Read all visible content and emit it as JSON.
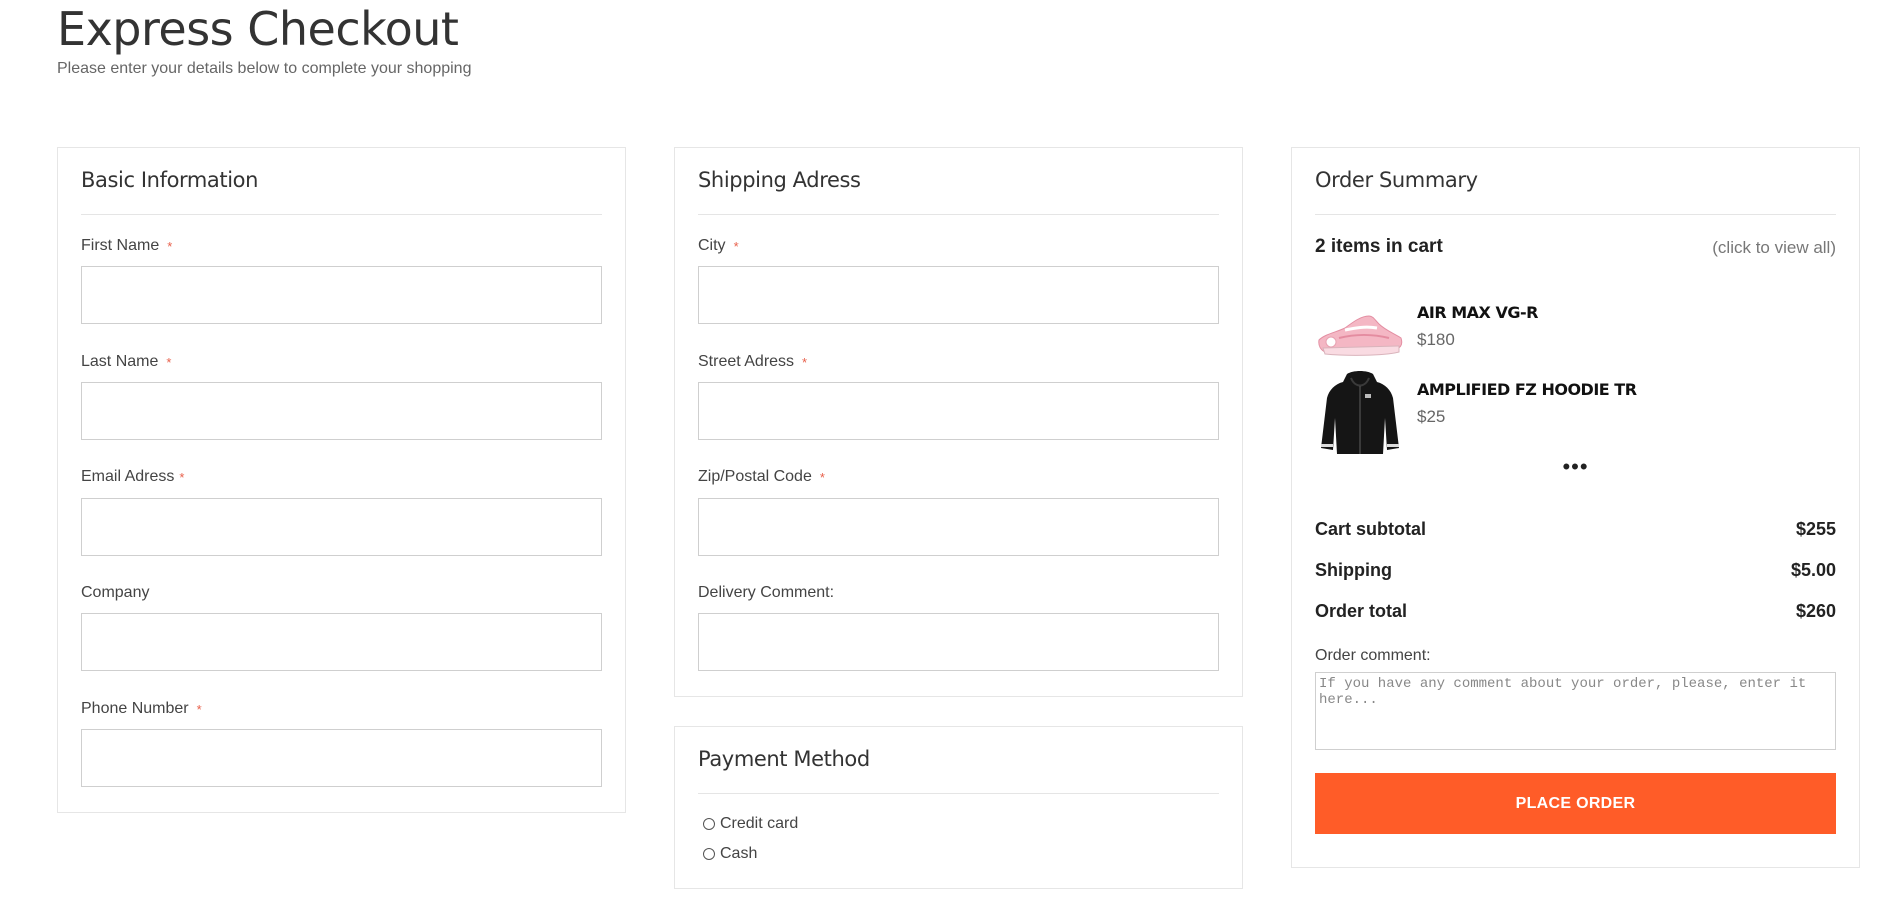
{
  "page": {
    "title": "Express Checkout",
    "subtitle": "Please enter your details below to complete your shopping"
  },
  "basic_info": {
    "title": "Basic Information",
    "fields": [
      {
        "label": "First Name",
        "required": "*",
        "value": ""
      },
      {
        "label": "Last Name",
        "required": "*",
        "value": ""
      },
      {
        "label": "Email Adress",
        "required": "*",
        "value": ""
      },
      {
        "label": "Company",
        "value": ""
      },
      {
        "label": "Phone Number",
        "required": "*",
        "value": ""
      }
    ]
  },
  "shipping": {
    "title": "Shipping Adress",
    "fields": [
      {
        "label": "City",
        "required": "*",
        "value": ""
      },
      {
        "label": "Street Adress",
        "required": "*",
        "value": ""
      },
      {
        "label": "Zip/Postal Code",
        "required": "*",
        "value": ""
      },
      {
        "label": "Delivery Comment:",
        "value": ""
      }
    ]
  },
  "payment": {
    "title": "Payment Method",
    "options": [
      {
        "label": "Credit card",
        "selected": false
      },
      {
        "label": "Cash",
        "selected": false
      }
    ]
  },
  "summary": {
    "title": "Order Summary",
    "cart_count": "2 items in cart",
    "view_all": "(click to view all)",
    "items": [
      {
        "name": "AIR MAX VG-R",
        "price": "$180",
        "thumb_icon": "pink-sneaker-image"
      },
      {
        "name": "AMPLIFIED FZ HOODIE TR",
        "price": "$25",
        "thumb_icon": "black-hoodie-image"
      }
    ],
    "more": "•••",
    "totals": [
      {
        "label": "Cart subtotal",
        "value": "$255"
      },
      {
        "label": "Shipping",
        "value": "$5.00"
      },
      {
        "label": "Order total",
        "value": "$260"
      }
    ],
    "comment_label": "Order comment:",
    "comment_placeholder": "If you have any comment about your order, please, enter it here...",
    "place_order": "PLACE ORDER"
  },
  "colors": {
    "accent": "#ff5c28",
    "required": "#e8604b",
    "border": "#cfcfcf"
  }
}
